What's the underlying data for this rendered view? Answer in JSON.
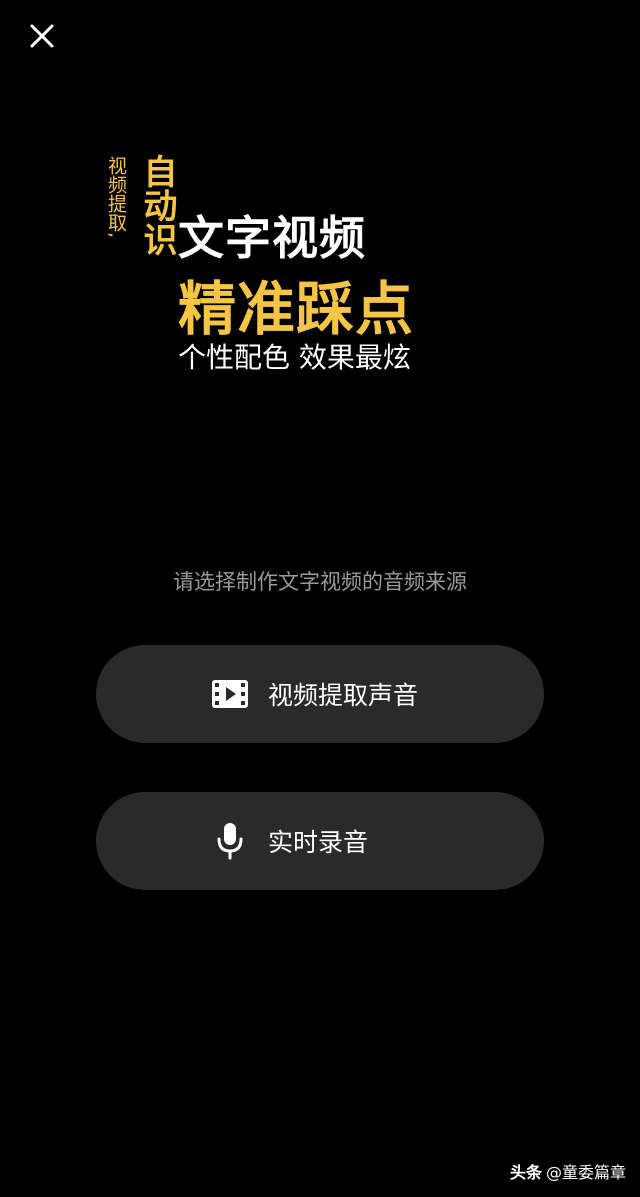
{
  "header": {
    "close_icon": "close-icon"
  },
  "hero": {
    "vertical_small": "视频提取,",
    "vertical_big": "自动识",
    "line1": "文字视频",
    "line2": "精准踩点",
    "line3": "个性配色  效果最炫"
  },
  "prompt": "请选择制作文字视频的音频来源",
  "options": [
    {
      "icon": "video-clip-icon",
      "label": "视频提取声音"
    },
    {
      "icon": "microphone-icon",
      "label": "实时录音"
    }
  ],
  "watermark": {
    "brand": "头条",
    "handle": "@童委篇章"
  },
  "colors": {
    "background": "#000000",
    "accent": "#f7c544",
    "button_bg": "#2a2a2a",
    "prompt_text": "#9a9a9a"
  }
}
